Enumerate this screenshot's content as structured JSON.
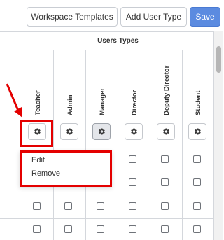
{
  "toolbar": {
    "workspace_templates_label": "Workspace Templates",
    "add_user_type_label": "Add User Type",
    "save_label": "Save"
  },
  "grid": {
    "group_title": "Users Types",
    "columns": [
      "Teacher",
      "Admin",
      "Manager",
      "Director",
      "Deputy Director",
      "Student"
    ],
    "active_gear_column": "Manager",
    "checkbox_rows_visible": 4
  },
  "context_menu": {
    "items": [
      "Edit",
      "Remove"
    ]
  },
  "colors": {
    "accent_blue": "#5b8be0",
    "annotation_red": "#e40000",
    "border": "#d4d7dc"
  },
  "icons": {
    "column_action": "gear-icon",
    "annotation": "red-arrow-icon"
  }
}
